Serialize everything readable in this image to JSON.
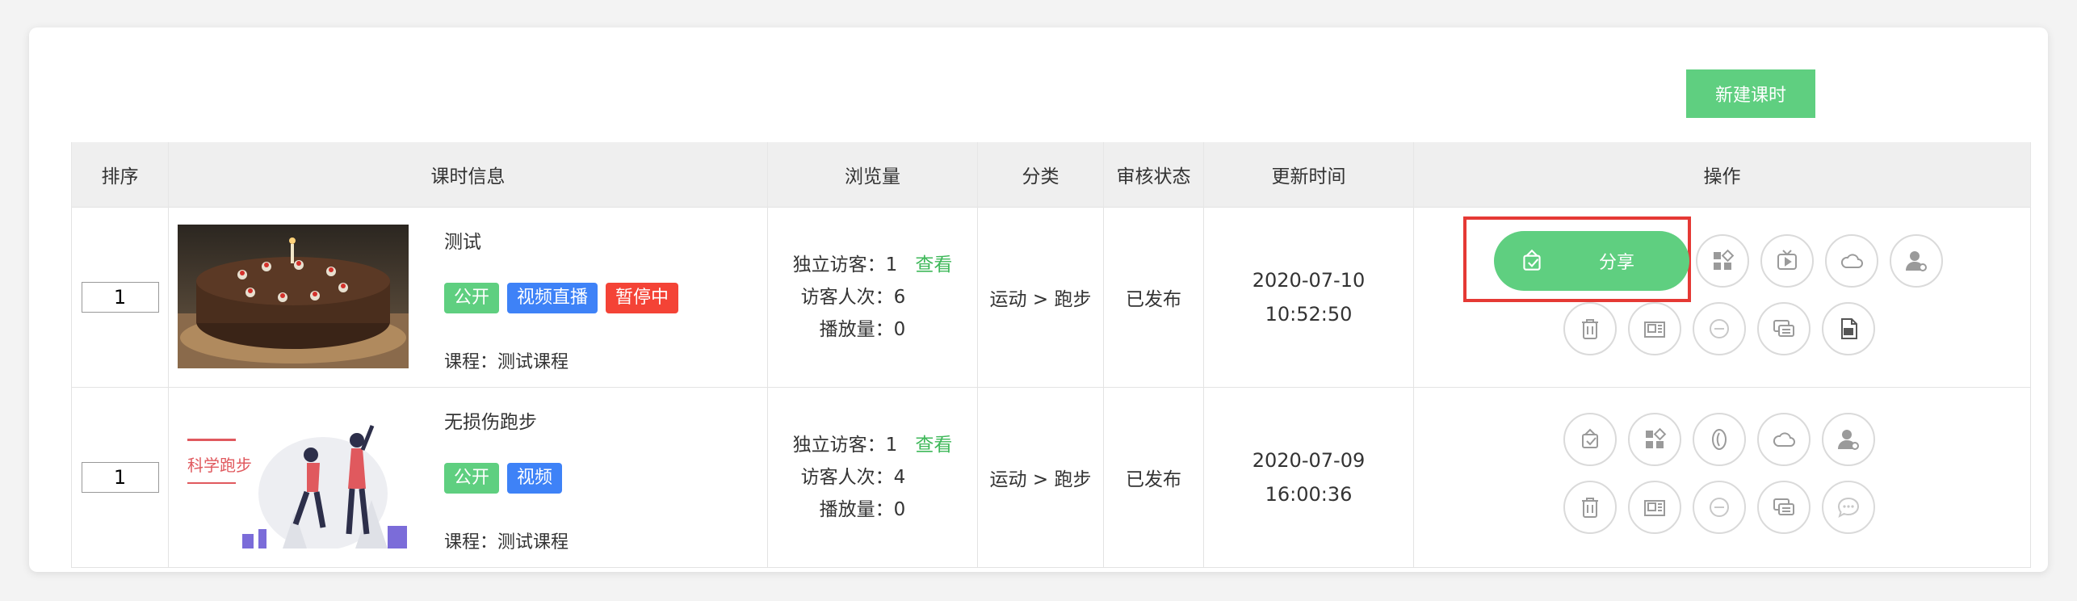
{
  "toolbar": {
    "new_lesson_label": "新建课时"
  },
  "table": {
    "headers": [
      "排序",
      "课时信息",
      "浏览量",
      "分类",
      "审核状态",
      "更新时间",
      "操作"
    ],
    "rows": [
      {
        "order": "1",
        "title": "测试",
        "tags": [
          "公开",
          "视频直播",
          "暂停中"
        ],
        "course_label": "课程：测试课程",
        "unique_visitors_label": "独立访客：1",
        "view_link": "查看",
        "visits_label": "访客人次：6",
        "plays_label": "播放量：0",
        "category": "运动 > 跑步",
        "status": "已发布",
        "date": "2020-07-10",
        "time": "10:52:50",
        "share_label": "分享"
      },
      {
        "order": "1",
        "title": "无损伤跑步",
        "tags": [
          "公开",
          "视频"
        ],
        "course_label": "课程：测试课程",
        "unique_visitors_label": "独立访客：1",
        "view_link": "查看",
        "visits_label": "访客人次：4",
        "plays_label": "播放量：0",
        "category": "运动 > 跑步",
        "status": "已发布",
        "date": "2020-07-09",
        "time": "16:00:36",
        "thumb_text": "科学跑步"
      }
    ]
  },
  "icons": {
    "row1": [
      "share-icon",
      "apps-icon",
      "tv-icon",
      "cloud-icon",
      "user-settings-icon",
      "trash-icon",
      "book-icon",
      "minus-circle-icon",
      "comments-icon",
      "file-icon"
    ],
    "row2": [
      "share-icon",
      "apps-icon",
      "leaf-icon",
      "cloud-icon",
      "user-settings-icon",
      "trash-icon",
      "book-icon",
      "minus-circle-icon",
      "comments-icon",
      "chat-icon"
    ]
  },
  "colors": {
    "accent": "#5fcf80",
    "blue_tag": "#3e82f7",
    "red_tag": "#f44336",
    "highlight": "#e53935"
  }
}
